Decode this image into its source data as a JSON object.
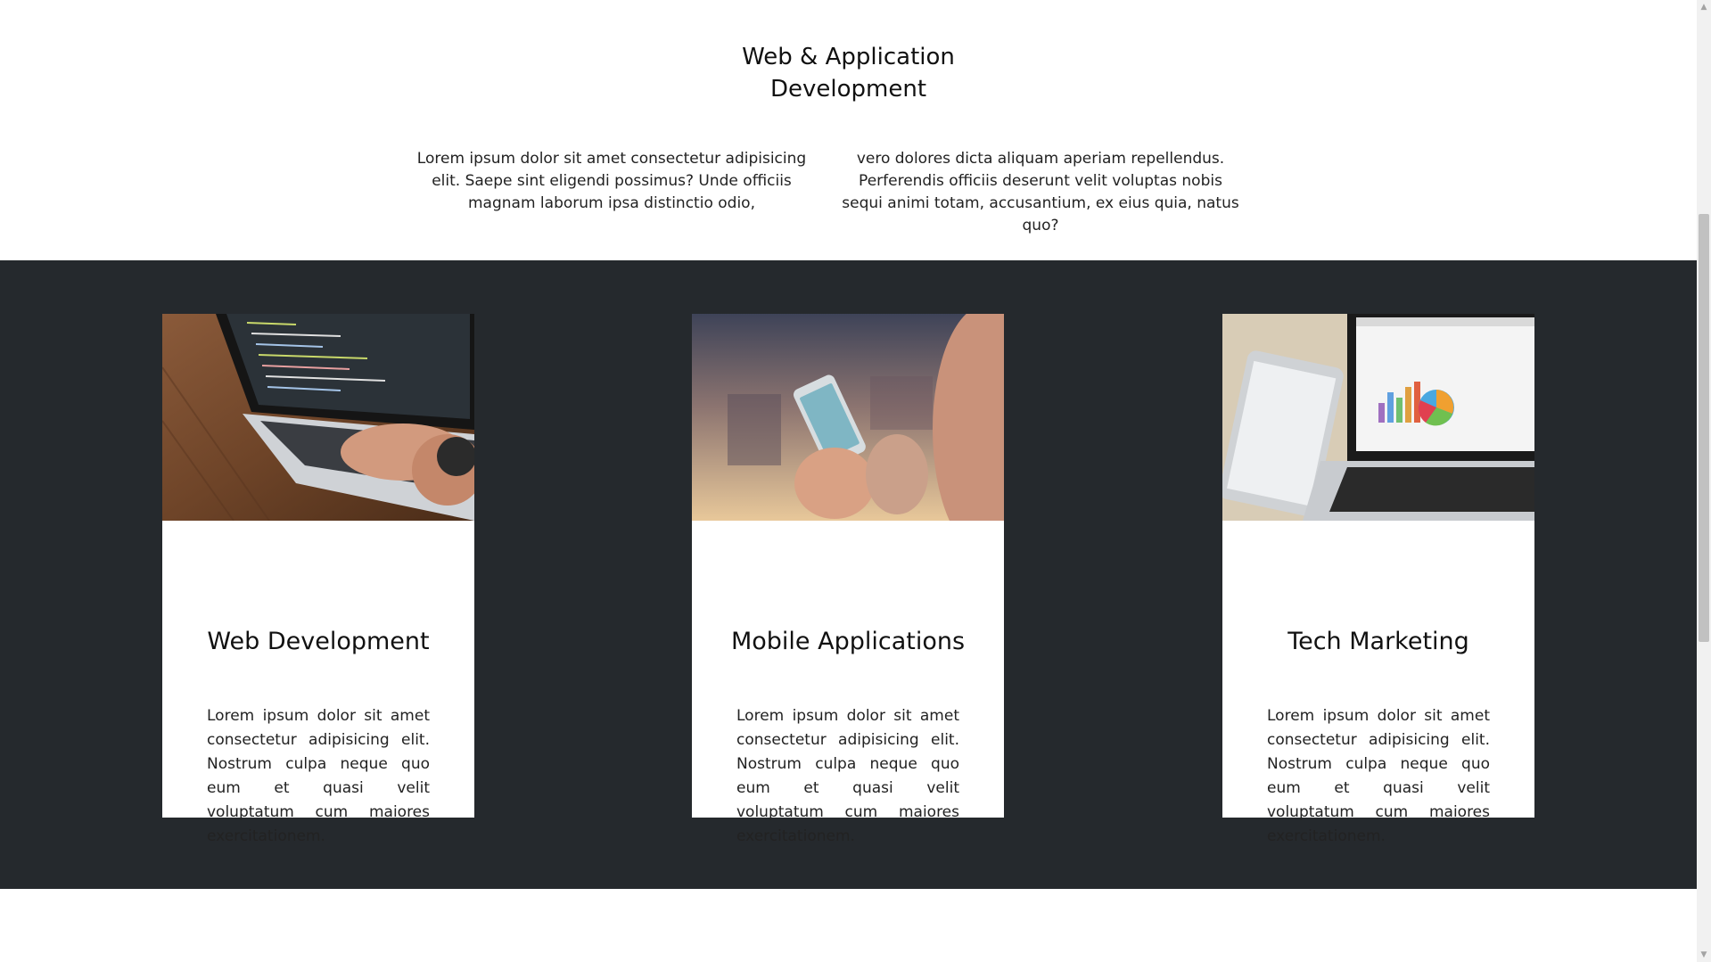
{
  "intro": {
    "title_line1": "Web & Application",
    "title_line2": "Development",
    "col_left": "Lorem ipsum dolor sit amet consectetur adipisicing elit. Saepe sint eligendi possimus? Unde officiis magnam laborum ipsa distinctio odio,",
    "col_right": "vero dolores dicta aliquam aperiam repellendus. Perferendis officiis deserunt velit voluptas nobis sequi animi totam, accusantium, ex eius quia, natus quo?"
  },
  "colors": {
    "dark_band": "#25292d",
    "card_bg": "#ffffff",
    "text": "#111111"
  },
  "cards": [
    {
      "image": "laptop-code-photo",
      "title": "Web Development",
      "text": "Lorem ipsum dolor sit amet consectetur adipisicing elit. Nostrum culpa neque quo eum et quasi velit voluptatum cum maiores exercitationem."
    },
    {
      "image": "smartphone-hands-photo",
      "title": "Mobile Applications",
      "text": "Lorem ipsum dolor sit amet consectetur adipisicing elit. Nostrum culpa neque quo eum et quasi velit voluptatum cum maiores exercitationem."
    },
    {
      "image": "laptop-charts-photo",
      "title": "Tech Marketing",
      "text": "Lorem ipsum dolor sit amet consectetur adipisicing elit. Nostrum culpa neque quo eum et quasi velit voluptatum cum maiores exercitationem."
    }
  ]
}
